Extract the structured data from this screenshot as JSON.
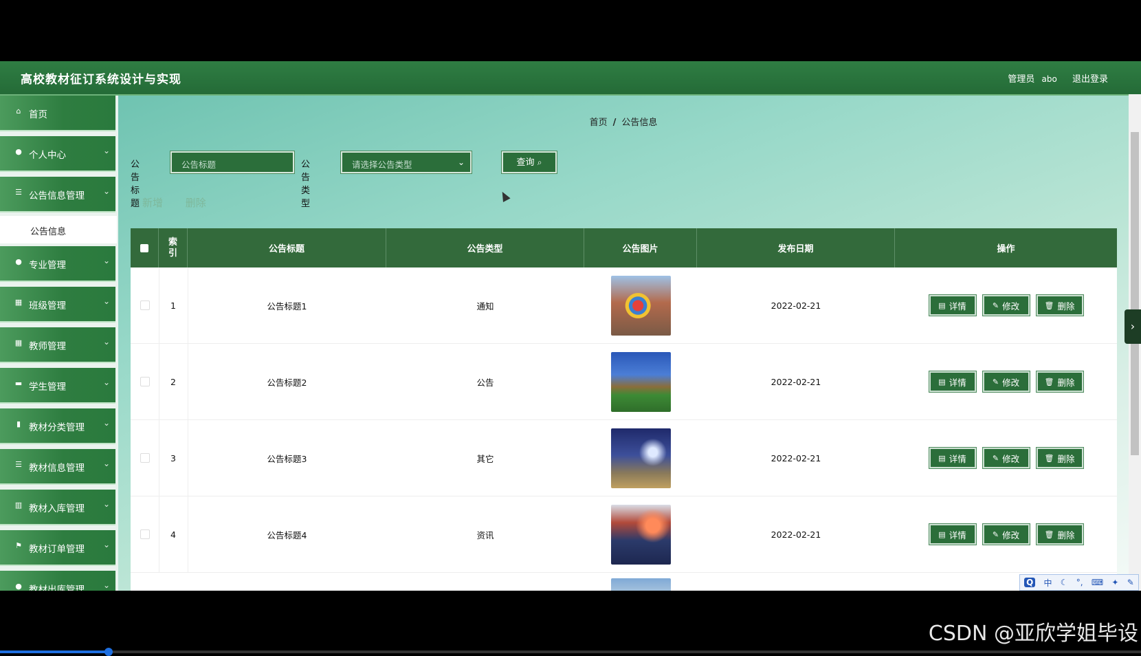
{
  "header": {
    "title": "高校教材征订系统设计与实现",
    "role": "管理员",
    "username": "abo",
    "logout": "退出登录"
  },
  "sidebar": {
    "items": [
      {
        "label": "首页",
        "icon": "home-icon",
        "glyph": "⌂",
        "chevron": false
      },
      {
        "label": "个人中心",
        "icon": "user-icon",
        "glyph": "●",
        "chevron": true
      },
      {
        "label": "公告信息管理",
        "icon": "list-icon",
        "glyph": "☰",
        "chevron": true
      },
      {
        "label": "专业管理",
        "icon": "user-icon",
        "glyph": "●",
        "chevron": true
      },
      {
        "label": "班级管理",
        "icon": "grid-icon",
        "glyph": "▦",
        "chevron": true
      },
      {
        "label": "教师管理",
        "icon": "grid-icon",
        "glyph": "▦",
        "chevron": true
      },
      {
        "label": "学生管理",
        "icon": "card-icon",
        "glyph": "▬",
        "chevron": true
      },
      {
        "label": "教材分类管理",
        "icon": "clipboard-icon",
        "glyph": "▮",
        "chevron": true
      },
      {
        "label": "教材信息管理",
        "icon": "list-icon",
        "glyph": "☰",
        "chevron": true
      },
      {
        "label": "教材入库管理",
        "icon": "bar-chart-icon",
        "glyph": "▥",
        "chevron": true
      },
      {
        "label": "教材订单管理",
        "icon": "flag-icon",
        "glyph": "⚑",
        "chevron": true
      },
      {
        "label": "教材出库管理",
        "icon": "circle-icon",
        "glyph": "●",
        "chevron": true
      }
    ],
    "submenu": {
      "label": "公告信息"
    }
  },
  "breadcrumb": {
    "home": "首页",
    "separator": "/",
    "current": "公告信息"
  },
  "search": {
    "title_label": "公告标题",
    "title_placeholder": "公告标题",
    "type_label": "公告类型",
    "type_placeholder": "请选择公告类型",
    "query_button": "查询",
    "query_icon": "search-icon"
  },
  "actions": {
    "add": "新增",
    "delete": "删除"
  },
  "table": {
    "columns": [
      "索引",
      "公告标题",
      "公告类型",
      "公告图片",
      "发布日期",
      "操作"
    ],
    "rows": [
      {
        "index": "1",
        "title": "公告标题1",
        "type": "通知",
        "date": "2022-02-21"
      },
      {
        "index": "2",
        "title": "公告标题2",
        "type": "公告",
        "date": "2022-02-21"
      },
      {
        "index": "3",
        "title": "公告标题3",
        "type": "其它",
        "date": "2022-02-21"
      },
      {
        "index": "4",
        "title": "公告标题4",
        "type": "资讯",
        "date": "2022-02-21"
      }
    ],
    "row_buttons": {
      "detail": "详情",
      "edit": "修改",
      "delete": "删除"
    }
  },
  "ime": {
    "badge": "Q",
    "mode": "中"
  },
  "watermark": "CSDN @亚欣学姐毕设",
  "colors": {
    "header": "#2a7a3d",
    "menu": "#2e7d40",
    "table_head": "#336a3b",
    "button": "#2b6e3a"
  }
}
